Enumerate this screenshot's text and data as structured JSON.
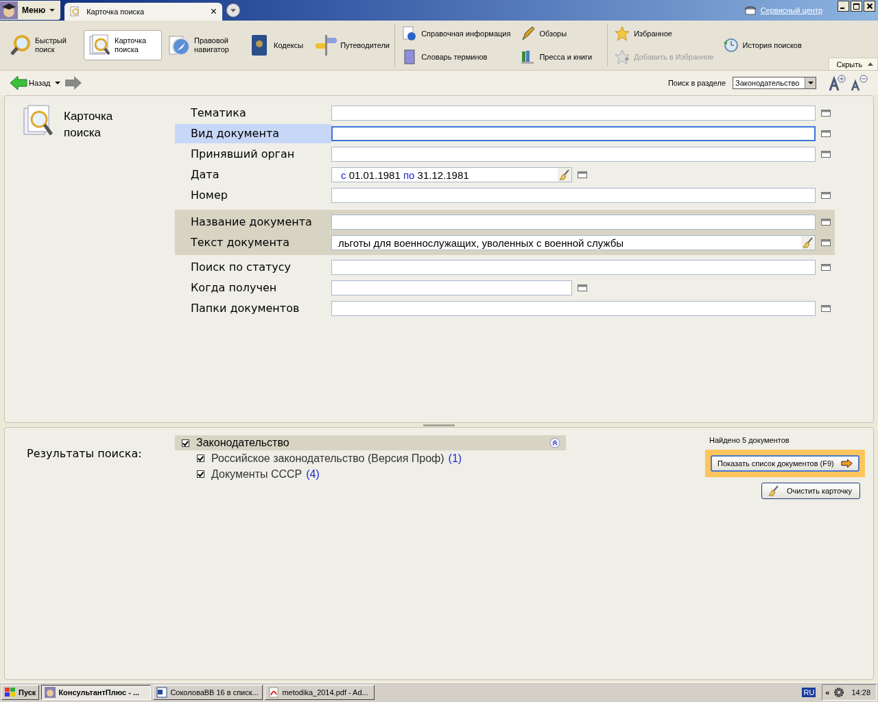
{
  "title_bar": {
    "menu_button": "Меню",
    "tab": {
      "label": "Карточка поиска",
      "close": "×",
      "selected": true
    },
    "service_link": "Сервисный центр"
  },
  "toolbar": {
    "big_buttons": [
      {
        "label": "Быстрый поиск",
        "selected": false
      },
      {
        "label": "Карточка поиска",
        "selected": true
      },
      {
        "label": "Правовой навигатор",
        "selected": false
      },
      {
        "label": "Кодексы",
        "selected": false
      },
      {
        "label": "Путеводители",
        "selected": false
      }
    ],
    "small_groups": [
      [
        {
          "label": "Справочная информация",
          "disabled": false
        },
        {
          "label": "Словарь терминов",
          "disabled": false
        }
      ],
      [
        {
          "label": "Обзоры",
          "disabled": false
        },
        {
          "label": "Пресса и книги",
          "disabled": false
        }
      ],
      [
        {
          "label": "Избранное",
          "disabled": false
        },
        {
          "label": "Добавить в Избранное",
          "disabled": true
        }
      ],
      [
        {
          "label": "История поисков",
          "disabled": false
        }
      ]
    ],
    "hide_button": "Скрыть"
  },
  "nav_bar": {
    "back": "Назад",
    "search_in_label": "Поиск в разделе",
    "search_in_value": "Законодательство"
  },
  "card": {
    "title": "Карточка поиска",
    "field_groups": [
      {
        "highlighted": false,
        "fields": [
          {
            "label": "Тематика",
            "kind": "full",
            "selected": false
          },
          {
            "label": "Вид документа",
            "kind": "full",
            "selected": true
          },
          {
            "label": "Принявший орган",
            "kind": "full",
            "selected": false
          },
          {
            "label": "Дата",
            "kind": "date",
            "selected": false,
            "from_word": "с",
            "from": "01.01.1981",
            "to_word": "по",
            "to": "31.12.1981"
          },
          {
            "label": "Номер",
            "kind": "full",
            "selected": false
          }
        ]
      },
      {
        "highlighted": true,
        "fields": [
          {
            "label": "Название документа",
            "kind": "full",
            "selected": false
          },
          {
            "label": "Текст документа",
            "kind": "text",
            "selected": false,
            "value": "льготы для военнослужащих, уволенных с военной службы"
          }
        ]
      },
      {
        "highlighted": false,
        "fields": [
          {
            "label": "Поиск по статусу",
            "kind": "full",
            "selected": false
          },
          {
            "label": "Когда получен",
            "kind": "short",
            "selected": false
          },
          {
            "label": "Папки документов",
            "kind": "full",
            "selected": false
          }
        ]
      }
    ]
  },
  "results": {
    "title": "Результаты поиска:",
    "tree": {
      "label": "Законодательство",
      "checked": true,
      "children": [
        {
          "label": "Российское законодательство (Версия Проф)",
          "count": "(1)",
          "checked": true
        },
        {
          "label": "Документы СССР",
          "count": "(4)",
          "checked": true
        }
      ]
    },
    "found": "Найдено 5 документов",
    "show_button": "Показать список документов (F9)",
    "clear_button": "Очистить карточку"
  },
  "taskbar": {
    "start": "Пуск",
    "tasks": [
      {
        "label": "КонсультантПлюс - ...",
        "selected": true
      },
      {
        "label": "СоколоваВВ 16 в списк...",
        "selected": false
      },
      {
        "label": "metodika_2014.pdf - Ad...",
        "selected": false
      }
    ],
    "language": "RU",
    "tray_toggle": "«",
    "clock": "14:28"
  }
}
